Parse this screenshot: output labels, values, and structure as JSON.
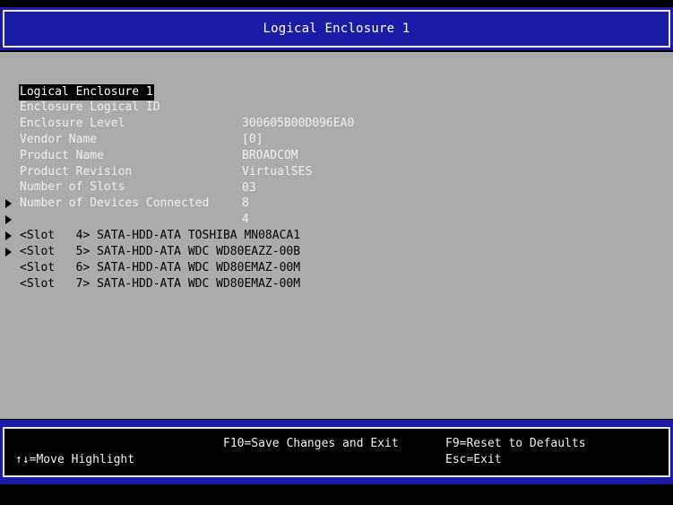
{
  "header": {
    "title": "Logical Enclosure 1"
  },
  "section": {
    "heading": "Logical Enclosure 1"
  },
  "fields": [
    {
      "label": "Enclosure Logical ID",
      "value": "300605B00D096EA0"
    },
    {
      "label": "Enclosure Level",
      "value": "[0]"
    },
    {
      "label": "Vendor Name",
      "value": "BROADCOM"
    },
    {
      "label": "Product Name",
      "value": "VirtualSES"
    },
    {
      "label": "Product Revision",
      "value": "03"
    },
    {
      "label": "Number of Slots",
      "value": "8"
    },
    {
      "label": "Number of Devices Connected",
      "value": "4"
    }
  ],
  "slots": [
    {
      "text": "<Slot   4> SATA-HDD-ATA TOSHIBA MN08ACA1"
    },
    {
      "text": "<Slot   5> SATA-HDD-ATA WDC WD80EAZZ-00B"
    },
    {
      "text": "<Slot   6> SATA-HDD-ATA WDC WD80EMAZ-00M"
    },
    {
      "text": "<Slot   7> SATA-HDD-ATA WDC WD80EMAZ-00M"
    }
  ],
  "footer": {
    "f10": "F10=Save Changes and Exit",
    "f9": "F9=Reset to Defaults",
    "move": "↑↓=Move Highlight",
    "esc": "Esc=Exit"
  }
}
